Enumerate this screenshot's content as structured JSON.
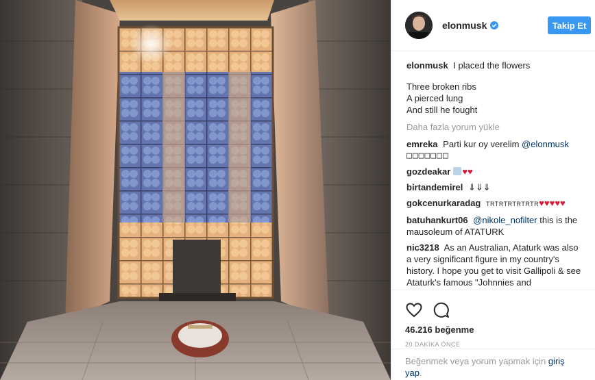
{
  "header": {
    "username": "elonmusk",
    "follow_label": "Takip Et"
  },
  "caption": {
    "user": "elonmusk",
    "text": "I placed the flowers",
    "lines": [
      "Three broken ribs",
      "A pierced lung",
      "And still he fought"
    ]
  },
  "load_more": "Daha fazla yorum yükle",
  "comments": [
    {
      "user": "emreka",
      "text": "Parti kur oy verelim",
      "mention": "@elonmusk",
      "extra": "□□□□□□□"
    },
    {
      "user": "gozdeakar",
      "text": "",
      "hearts": "♥♥"
    },
    {
      "user": "birtandemirel",
      "text": "⇓⇓⇓"
    },
    {
      "user": "gokcenurkaradag",
      "text": "TRTRTRTRTRTR",
      "hearts": "♥♥♥♥♥"
    },
    {
      "user": "batuhankurt06",
      "mention": "@nikole_nofilter",
      "text": "this is the mausoleum of ATATURK"
    },
    {
      "user": "nic3218",
      "text": "As an Australian, Ataturk was also a very significant figure in my country's history. I hope you get to visit Gallipoli & see Ataturk's famous \"Johnnies and"
    }
  ],
  "likes": "46.216 beğenme",
  "timestamp": "20 DAKİKA ÖNCE",
  "login": {
    "prefix": "Beğenmek veya yorum yapmak için",
    "link": "giriş yap",
    "suffix": "."
  },
  "icons": {
    "like": "heart-icon",
    "comment": "comment-icon",
    "verified": "verified-badge-icon"
  },
  "colors": {
    "accent": "#3897f0",
    "link": "#003569",
    "muted": "#999999",
    "heart": "#d81b3a"
  }
}
